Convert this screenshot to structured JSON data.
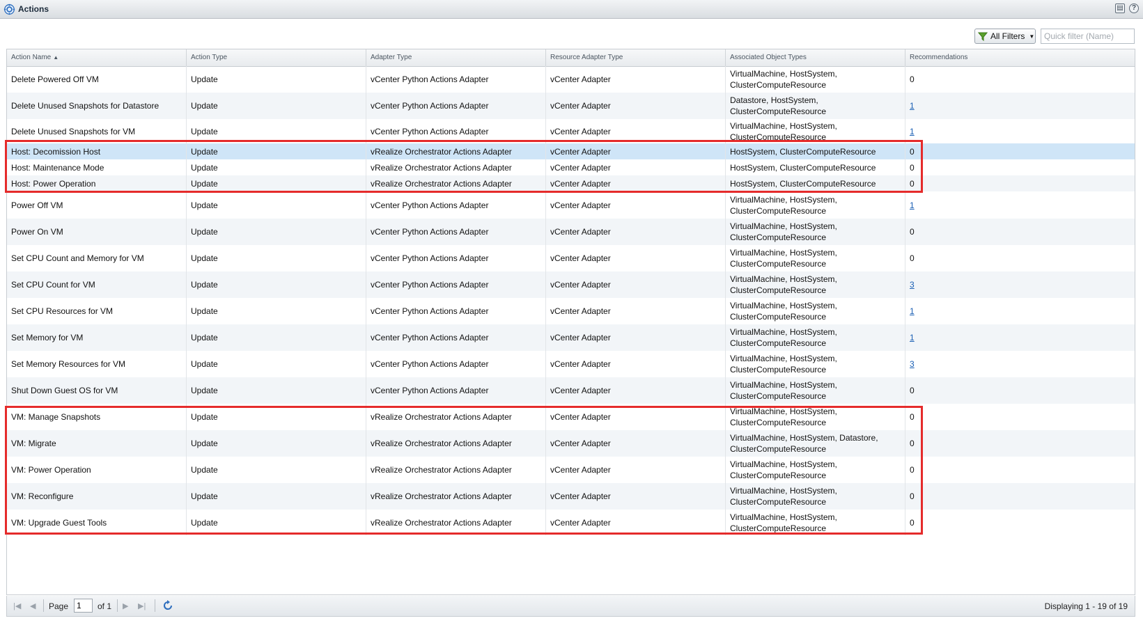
{
  "window": {
    "title": "Actions"
  },
  "toolbar": {
    "filter_label": "All Filters",
    "quick_filter_placeholder": "Quick filter (Name)"
  },
  "columns": [
    "Action Name",
    "Action Type",
    "Adapter Type",
    "Resource Adapter Type",
    "Associated Object Types",
    "Recommendations"
  ],
  "rows": [
    {
      "name": "Delete Powered Off VM",
      "type": "Update",
      "adapter": "vCenter Python Actions Adapter",
      "resource": "vCenter Adapter",
      "objects": "VirtualMachine, HostSystem, ClusterComputeResource",
      "rec": "0",
      "rec_link": false
    },
    {
      "name": "Delete Unused Snapshots for Datastore",
      "type": "Update",
      "adapter": "vCenter Python Actions Adapter",
      "resource": "vCenter Adapter",
      "objects": "Datastore, HostSystem, ClusterComputeResource",
      "rec": "1",
      "rec_link": true
    },
    {
      "name": "Delete Unused Snapshots for VM",
      "type": "Update",
      "adapter": "vCenter Python Actions Adapter",
      "resource": "vCenter Adapter",
      "objects": "VirtualMachine, HostSystem, ClusterComputeResource",
      "rec": "1",
      "rec_link": true
    },
    {
      "name": "Host: Decomission Host",
      "type": "Update",
      "adapter": "vRealize Orchestrator Actions Adapter",
      "resource": "vCenter Adapter",
      "objects": "HostSystem, ClusterComputeResource",
      "rec": "0",
      "rec_link": false
    },
    {
      "name": "Host: Maintenance Mode",
      "type": "Update",
      "adapter": "vRealize Orchestrator Actions Adapter",
      "resource": "vCenter Adapter",
      "objects": "HostSystem, ClusterComputeResource",
      "rec": "0",
      "rec_link": false
    },
    {
      "name": "Host: Power Operation",
      "type": "Update",
      "adapter": "vRealize Orchestrator Actions Adapter",
      "resource": "vCenter Adapter",
      "objects": "HostSystem, ClusterComputeResource",
      "rec": "0",
      "rec_link": false
    },
    {
      "name": "Power Off VM",
      "type": "Update",
      "adapter": "vCenter Python Actions Adapter",
      "resource": "vCenter Adapter",
      "objects": "VirtualMachine, HostSystem, ClusterComputeResource",
      "rec": "1",
      "rec_link": true
    },
    {
      "name": "Power On VM",
      "type": "Update",
      "adapter": "vCenter Python Actions Adapter",
      "resource": "vCenter Adapter",
      "objects": "VirtualMachine, HostSystem, ClusterComputeResource",
      "rec": "0",
      "rec_link": false
    },
    {
      "name": "Set CPU Count and Memory for VM",
      "type": "Update",
      "adapter": "vCenter Python Actions Adapter",
      "resource": "vCenter Adapter",
      "objects": "VirtualMachine, HostSystem, ClusterComputeResource",
      "rec": "0",
      "rec_link": false
    },
    {
      "name": "Set CPU Count for VM",
      "type": "Update",
      "adapter": "vCenter Python Actions Adapter",
      "resource": "vCenter Adapter",
      "objects": "VirtualMachine, HostSystem, ClusterComputeResource",
      "rec": "3",
      "rec_link": true
    },
    {
      "name": "Set CPU Resources for VM",
      "type": "Update",
      "adapter": "vCenter Python Actions Adapter",
      "resource": "vCenter Adapter",
      "objects": "VirtualMachine, HostSystem, ClusterComputeResource",
      "rec": "1",
      "rec_link": true
    },
    {
      "name": "Set Memory for VM",
      "type": "Update",
      "adapter": "vCenter Python Actions Adapter",
      "resource": "vCenter Adapter",
      "objects": "VirtualMachine, HostSystem, ClusterComputeResource",
      "rec": "1",
      "rec_link": true
    },
    {
      "name": "Set Memory Resources for VM",
      "type": "Update",
      "adapter": "vCenter Python Actions Adapter",
      "resource": "vCenter Adapter",
      "objects": "VirtualMachine, HostSystem, ClusterComputeResource",
      "rec": "3",
      "rec_link": true
    },
    {
      "name": "Shut Down Guest OS for VM",
      "type": "Update",
      "adapter": "vCenter Python Actions Adapter",
      "resource": "vCenter Adapter",
      "objects": "VirtualMachine, HostSystem, ClusterComputeResource",
      "rec": "0",
      "rec_link": false
    },
    {
      "name": "VM: Manage Snapshots",
      "type": "Update",
      "adapter": "vRealize Orchestrator Actions Adapter",
      "resource": "vCenter Adapter",
      "objects": "VirtualMachine, HostSystem, ClusterComputeResource",
      "rec": "0",
      "rec_link": false
    },
    {
      "name": "VM: Migrate",
      "type": "Update",
      "adapter": "vRealize Orchestrator Actions Adapter",
      "resource": "vCenter Adapter",
      "objects": "VirtualMachine, HostSystem, Datastore, ClusterComputeResource",
      "rec": "0",
      "rec_link": false
    },
    {
      "name": "VM: Power Operation",
      "type": "Update",
      "adapter": "vRealize Orchestrator Actions Adapter",
      "resource": "vCenter Adapter",
      "objects": "VirtualMachine, HostSystem, ClusterComputeResource",
      "rec": "0",
      "rec_link": false
    },
    {
      "name": "VM: Reconfigure",
      "type": "Update",
      "adapter": "vRealize Orchestrator Actions Adapter",
      "resource": "vCenter Adapter",
      "objects": "VirtualMachine, HostSystem, ClusterComputeResource",
      "rec": "0",
      "rec_link": false
    },
    {
      "name": "VM: Upgrade Guest Tools",
      "type": "Update",
      "adapter": "vRealize Orchestrator Actions Adapter",
      "resource": "vCenter Adapter",
      "objects": "VirtualMachine, HostSystem, ClusterComputeResource",
      "rec": "0",
      "rec_link": false
    }
  ],
  "selected_row": 3,
  "pager": {
    "page_label": "Page",
    "page_value": "1",
    "of_label": "of 1",
    "display_text": "Displaying 1 - 19 of 19"
  },
  "colors": {
    "highlight": "#e52b2b",
    "selected": "#cfe5f7",
    "link": "#1a5fb4"
  }
}
